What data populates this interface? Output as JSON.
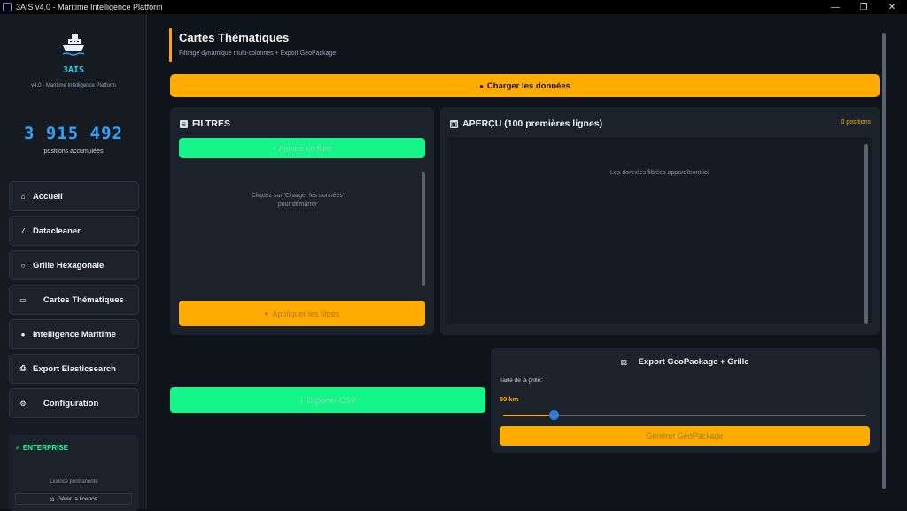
{
  "window": {
    "title": "3AIS v4.0 - Maritime Intelligence Platform",
    "controls": [
      "—",
      "❐",
      "✕"
    ]
  },
  "sidebar": {
    "brand": "3AIS",
    "subtitle": "v4.0 - Maritime Intelligence Platform",
    "positions_count": "3 915 492",
    "positions_label": "positions accumulées",
    "items": [
      {
        "label": "Accueil",
        "icon": "home-icon",
        "glyph": "⌂"
      },
      {
        "label": "Datacleaner",
        "icon": "brush-icon",
        "glyph": "⁄"
      },
      {
        "label": "Grille Hexagonale",
        "icon": "hexagon-icon",
        "glyph": "○"
      },
      {
        "label": "Cartes Thématiques",
        "icon": "map-icon",
        "glyph": "▭"
      },
      {
        "label": "Intelligence Maritime",
        "icon": "search-icon",
        "glyph": "●"
      },
      {
        "label": "Export Elasticsearch",
        "icon": "upload-icon",
        "glyph": "⎙"
      },
      {
        "label": "Configuration",
        "icon": "gear-icon",
        "glyph": "⚙"
      }
    ],
    "license": {
      "badge": "✓  ENTERPRISE",
      "type": "Licence permanente",
      "manage_label": "Gérer la licence"
    }
  },
  "main": {
    "title": "Cartes Thématiques",
    "subtitle": "Filtrage dynamique multi-colonnes + Export GeoPackage",
    "load_button": "Charger les données",
    "filters": {
      "title": "FILTRES",
      "add_filter": "+ Ajouter un filtre",
      "hint_line1": "Cliquez sur 'Charger les données'",
      "hint_line2": "pour démarrer",
      "apply_button": "Appliquer les filtres"
    },
    "preview": {
      "title": "APERÇU (100 premières lignes)",
      "count": "0 positions",
      "hint": "Les données filtrées apparaîtront ici"
    },
    "export_csv": "Exporter CSV",
    "geopackage": {
      "title": "Export GeoPackage + Grille",
      "grid_label": "Taille de la grille:",
      "grid_value": "50 km",
      "slider_fraction": 0.14,
      "generate_button": "Générer GeoPackage"
    }
  },
  "colors": {
    "accent_orange": "#ffab00",
    "accent_green": "#15f58a",
    "counter_blue": "#2ea3ff",
    "brand_cyan": "#22d3ee"
  }
}
